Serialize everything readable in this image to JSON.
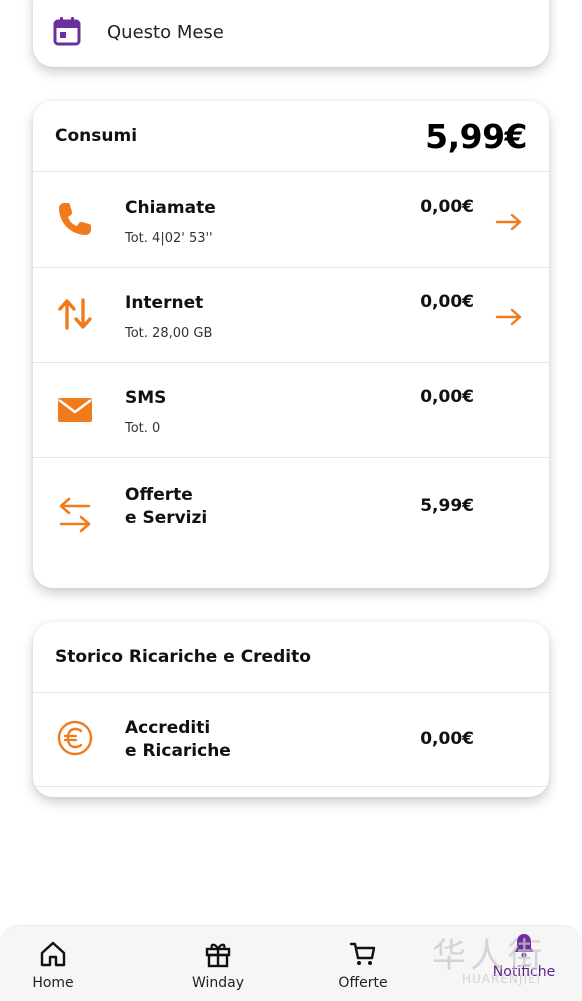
{
  "period": {
    "label": "Questo Mese",
    "icon": "calendar-icon"
  },
  "consumi": {
    "title": "Consumi",
    "total": "5,99€",
    "rows": [
      {
        "name": "Chiamate",
        "sub": "Tot. 4|02' 53''",
        "amount": "0,00€",
        "icon": "phone-icon",
        "arrow": true
      },
      {
        "name": "Internet",
        "sub": "Tot. 28,00 GB",
        "amount": "0,00€",
        "icon": "data-transfer-icon",
        "arrow": true
      },
      {
        "name": "SMS",
        "sub": "Tot. 0",
        "amount": "0,00€",
        "icon": "envelope-icon",
        "arrow": false
      },
      {
        "name_line1": "Offerte",
        "name_line2": "e Servizi",
        "amount": "5,99€",
        "icon": "swap-arrows-icon",
        "arrow": false
      }
    ]
  },
  "storico": {
    "title": "Storico Ricariche e Credito",
    "rows": [
      {
        "name_line1": "Accrediti",
        "name_line2": "e Ricariche",
        "amount": "0,00€",
        "icon": "euro-coin-icon"
      }
    ]
  },
  "nav": {
    "items": [
      {
        "label": "Home",
        "icon": "home-icon"
      },
      {
        "label": "Winday",
        "icon": "gift-icon"
      },
      {
        "label": "Offerte",
        "icon": "cart-icon"
      },
      {
        "label": "Notifiche",
        "icon": "bell-icon",
        "active": true
      }
    ]
  },
  "watermark": {
    "cn": "华人街",
    "en": "HUARENJIEI"
  },
  "colors": {
    "accent_orange": "#f07b1d",
    "brand_purple": "#6b2fa0",
    "text": "#111111"
  }
}
